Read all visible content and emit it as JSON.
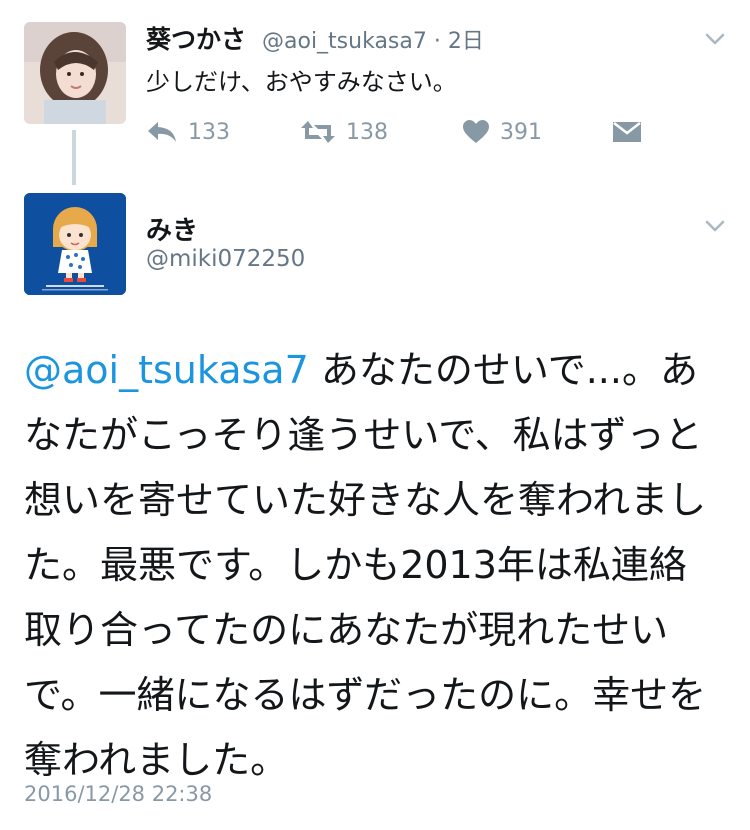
{
  "parent_tweet": {
    "display_name": "葵つかさ",
    "handle_time": "@aoi_tsukasa7 · 2日",
    "text": "少しだけ、おやすみなさい。",
    "reply_count": "133",
    "retweet_count": "138",
    "like_count": "391"
  },
  "reply_tweet": {
    "display_name": "みき",
    "handle": "@miki072250",
    "mention": "@aoi_tsukasa7",
    "text_after_mention": " あなたのせいで...。あなたがこっそり逢うせいで、私はずっと想いを寄せていた好きな人を奪われました。最悪です。しかも2013年は私連絡取り合ってたのにあなたが現れたせいで。一緒になるはずだったのに。幸せを奪われました。",
    "timestamp": "2016/12/28 22:38"
  },
  "colors": {
    "link": "#1b95e0",
    "secondary_text": "#657786",
    "icon_gray": "#8899a6"
  }
}
